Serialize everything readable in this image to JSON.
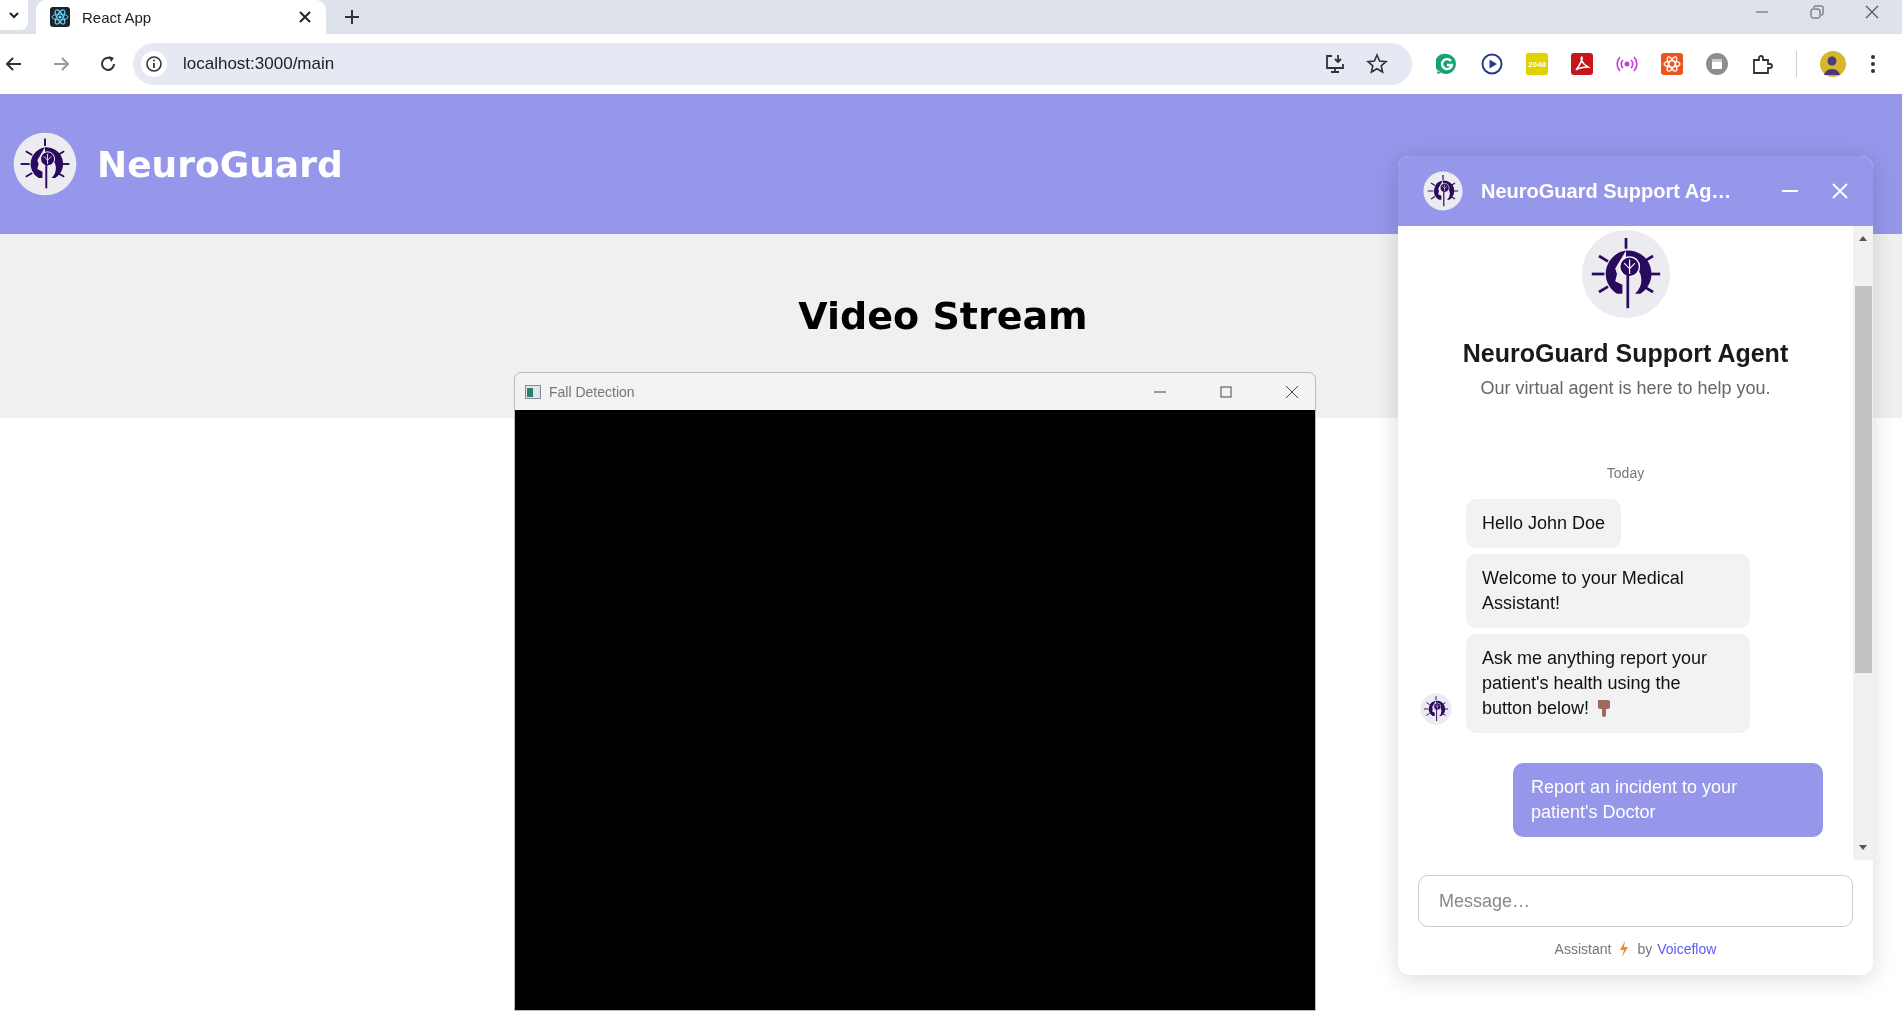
{
  "browser": {
    "tab": {
      "title": "React App",
      "selected": true
    },
    "address": "localhost:3000/main",
    "extensions": [
      {
        "kind": "green"
      },
      {
        "kind": "play"
      },
      {
        "kind": "tile",
        "label": "2048"
      },
      {
        "kind": "pdf"
      },
      {
        "kind": "broadcast"
      },
      {
        "kind": "atom"
      },
      {
        "kind": "calendar"
      },
      {
        "kind": "puzzle"
      }
    ]
  },
  "header": {
    "brand": "NeuroGuard"
  },
  "main": {
    "heading": "Video Stream",
    "window": {
      "title": "Fall Detection"
    }
  },
  "chat": {
    "title": "NeuroGuard Support Ag…",
    "agent_name": "NeuroGuard Support Agent",
    "agent_tagline": "Our virtual agent is here to help you.",
    "date": "Today",
    "messages": [
      {
        "text": "Hello John Doe",
        "emoji": false
      },
      {
        "text": "Welcome to your Medical Assistant!",
        "emoji": false
      },
      {
        "text": "Ask me anything report your patient's health using the button below!",
        "emoji": true
      }
    ],
    "action": "Report an incident to your patient's Doctor",
    "input": {
      "placeholder": "Message…"
    },
    "footer": {
      "prefix": "Assistant",
      "by": "by",
      "link": "Voiceflow"
    }
  }
}
